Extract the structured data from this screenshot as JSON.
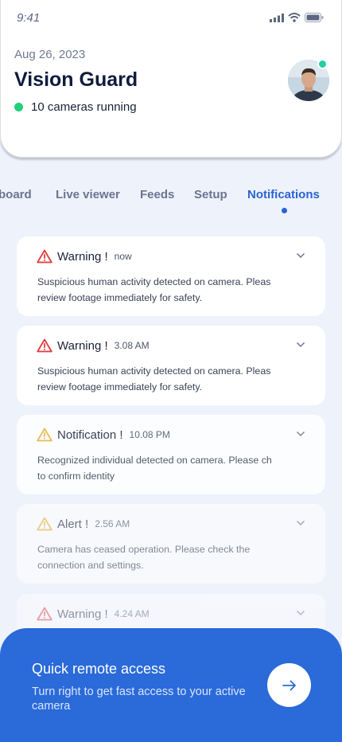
{
  "status_bar": {
    "time": "9:41"
  },
  "header": {
    "date": "Aug 26, 2023",
    "title": "Vision Guard",
    "cameras_running": "10 cameras running"
  },
  "tabs": [
    {
      "label": "board"
    },
    {
      "label": "Live viewer"
    },
    {
      "label": "Feeds"
    },
    {
      "label": "Setup"
    },
    {
      "label": "Notifications",
      "active": true
    }
  ],
  "notifications": [
    {
      "kind": "Warning !",
      "time": "now",
      "severity": "danger",
      "color": "#e03a3a",
      "message_line1": "Suspicious human activity detected on camera. Pleas",
      "message_line2": "review footage immediately for safety."
    },
    {
      "kind": "Warning !",
      "time": "3.08 AM",
      "severity": "danger",
      "color": "#e03a3a",
      "message_line1": "Suspicious human activity detected on camera. Pleas",
      "message_line2": "review footage immediately for safety."
    },
    {
      "kind": "Notification !",
      "time": "10.08 PM",
      "severity": "notice",
      "color": "#e8b33a",
      "message_line1": "Recognized individual detected on camera. Please ch",
      "message_line2": "to confirm identity"
    },
    {
      "kind": "Alert !",
      "time": "2.56 AM",
      "severity": "notice",
      "color": "#e8b33a",
      "message_line1": "Camera has ceased operation. Please check the",
      "message_line2": "connection and settings."
    },
    {
      "kind": "Warning !",
      "time": "4.24 AM",
      "severity": "danger",
      "color": "#e03a3a",
      "message_line1": "",
      "message_line2": ""
    }
  ],
  "bottom_panel": {
    "title": "Quick remote access",
    "subtitle": "Turn right to get fast access to your active camera"
  },
  "colors": {
    "accent": "#2a63d4",
    "online": "#22d07a",
    "panel": "#2a6ad9"
  }
}
